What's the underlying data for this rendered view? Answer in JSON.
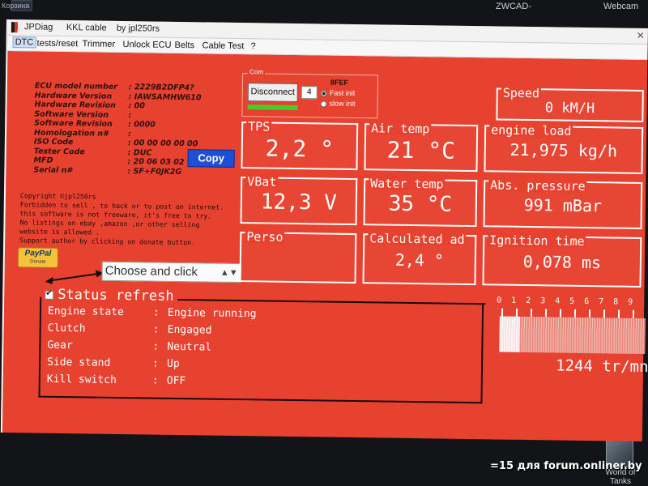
{
  "desktop": {
    "left_label": "Корзина",
    "zwcad_label": "ZWCAD-",
    "webcam_label": "Webcam",
    "wot_label": "World of Tanks",
    "watermark": "=15 для forum.onliner.by"
  },
  "window": {
    "tabs": [
      "JPDiag",
      "KKL cable",
      "by jpl250rs"
    ],
    "close_glyph": "✕"
  },
  "menu": [
    "DTC",
    "tests/reset",
    "Trimmer",
    "Unlock ECU",
    "Belts",
    "Cable Test",
    "?"
  ],
  "ecu": {
    "rows": [
      {
        "label": "ECU model number",
        "value": ": 2229B2DFP4?"
      },
      {
        "label": "Hardware Version",
        "value": ": IAWSAMHW610"
      },
      {
        "label": "Hardware Revision",
        "value": ": 00"
      },
      {
        "label": "Software Version",
        "value": ":"
      },
      {
        "label": "Software Revision",
        "value": ": 0000"
      },
      {
        "label": "Homologation n#",
        "value": ":"
      },
      {
        "label": "ISO Code",
        "value": ": 00 00 00 00 00"
      },
      {
        "label": "Tester Code",
        "value": ": DUC"
      },
      {
        "label": "MFD",
        "value": ": 20 06 03 02"
      },
      {
        "label": "Serial n#",
        "value": ": SF+F0JK2G"
      }
    ],
    "copy_label": "Copy"
  },
  "copyright": [
    "Copyright ©jpl250rs",
    "Forbidden to sell , to hack or to post on internet.",
    "this software is not freeware, it's free to try.",
    "No listings on ebay ,amazon ,or other selling",
    "website is allowed .",
    "Support author by clicking on donate button."
  ],
  "paypal": {
    "logo": "PayPal",
    "sub": "Donate"
  },
  "choose": {
    "label": "Choose and click",
    "arrow": "▲▼"
  },
  "com": {
    "label": "Com",
    "disconnect_label": "Disconnect",
    "port": "4",
    "id": "8FEF",
    "fast_init": "Fast init",
    "slow_init": "slow init"
  },
  "gauges": {
    "speed": {
      "label": "Speed",
      "value": "0 kM/H"
    },
    "tps": {
      "label": "TPS",
      "value": "2,2  °"
    },
    "air_temp": {
      "label": "Air temp",
      "value": "21 °C"
    },
    "engine_load": {
      "label": "engine load",
      "value": "21,975 kg/h"
    },
    "vbat": {
      "label": "VBat",
      "value": "12,3 V"
    },
    "water_temp": {
      "label": "Water temp",
      "value": "35 °C"
    },
    "abs_pressure": {
      "label": "Abs. pressure",
      "value": "991 mBar"
    },
    "perso": {
      "label": "Perso",
      "value": ""
    },
    "calculated_ad": {
      "label": "Calculated ad",
      "value": "2,4 °"
    },
    "ignition_time": {
      "label": "Ignition time",
      "value": "0,078 ms"
    }
  },
  "status": {
    "title": "Status refresh",
    "rows": [
      {
        "key": "Engine state",
        "sep": ":",
        "val": "Engine running"
      },
      {
        "key": "Clutch",
        "sep": ":",
        "val": "Engaged"
      },
      {
        "key": "Gear",
        "sep": ":",
        "val": "Neutral"
      },
      {
        "key": "Side stand",
        "sep": ":",
        "val": "Up"
      },
      {
        "key": "Kill switch",
        "sep": ":",
        "val": "OFF"
      }
    ]
  },
  "rpm": {
    "scale": [
      "0",
      "1",
      "2",
      "3",
      "4",
      "5",
      "6",
      "7",
      "8",
      "9"
    ],
    "value": "1244 tr/mn",
    "fill_fraction": 0.14
  },
  "colors": {
    "window_bg": "#e7412f",
    "copy_button": "#1f4fd6",
    "connection_ok": "#3fd12a"
  }
}
